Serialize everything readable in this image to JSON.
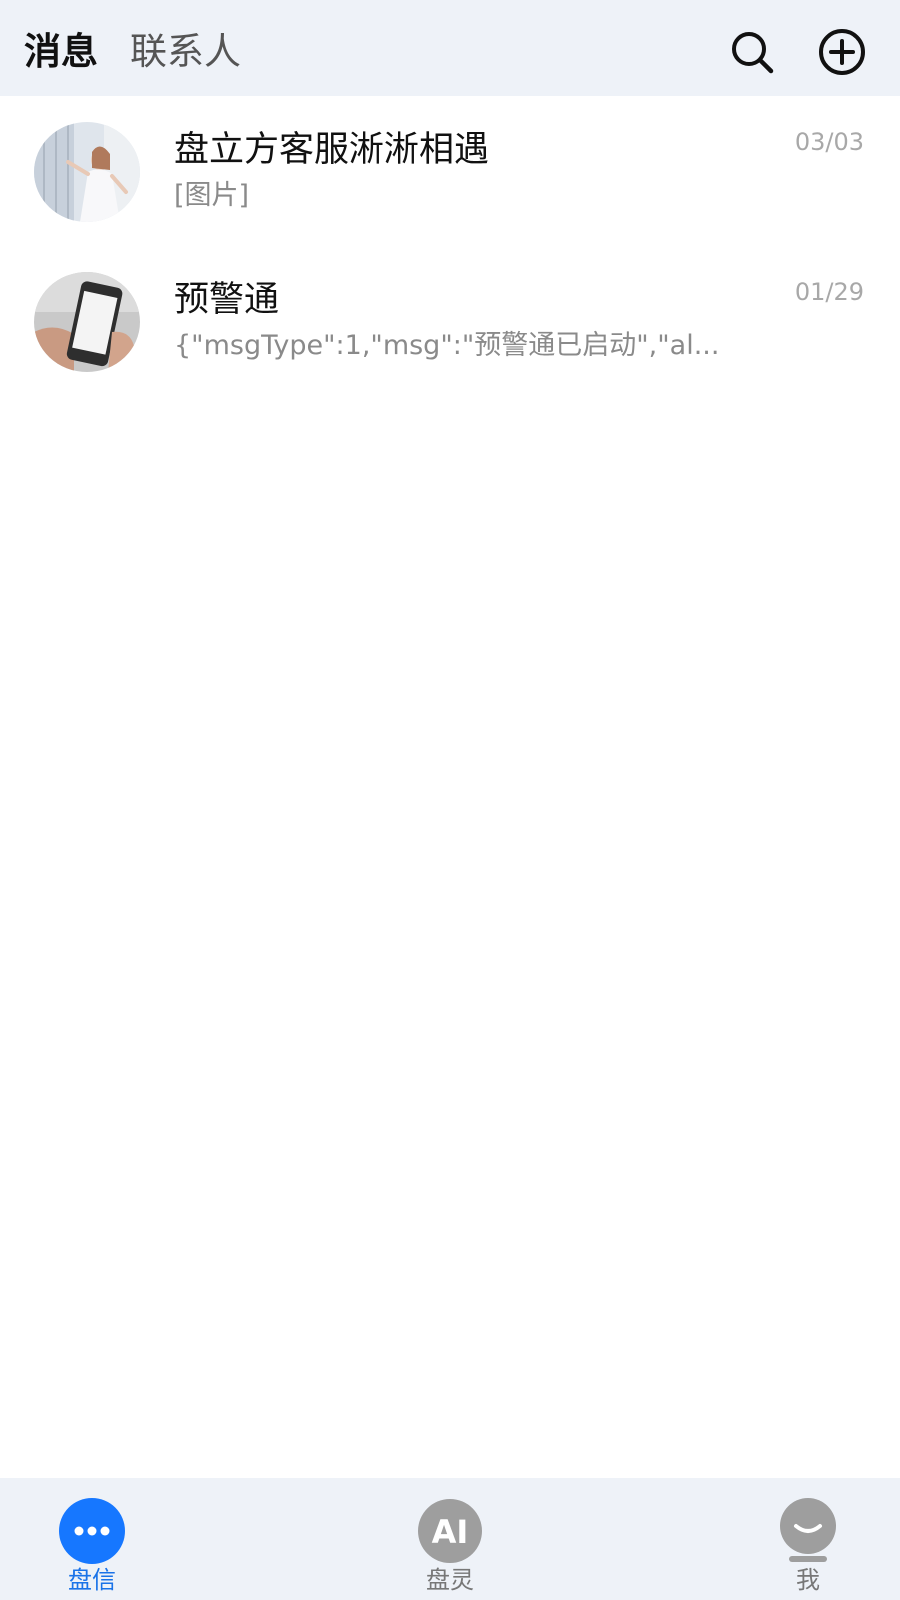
{
  "header": {
    "tabs": {
      "messages": "消息",
      "contacts": "联系人"
    },
    "icons": {
      "search": "search-icon",
      "add": "add-circle-icon"
    }
  },
  "chats": [
    {
      "name": "盘立方客服淅淅相遇",
      "preview": "[图片]",
      "date": "03/03",
      "avatar": "woman-photo-avatar"
    },
    {
      "name": "预警通",
      "preview": "{\"msgType\":1,\"msg\":\"预警通已启动\",\"al...",
      "date": "01/29",
      "avatar": "phone-in-hand-avatar"
    }
  ],
  "bottom_nav": {
    "items": [
      {
        "label": "盘信",
        "icon": "chat-bubble-icon",
        "active": true
      },
      {
        "label": "盘灵",
        "icon": "ai-badge-icon",
        "active": false
      },
      {
        "label": "我",
        "icon": "user-icon",
        "active": false
      }
    ],
    "ai_icon_text": "AI"
  },
  "colors": {
    "accent": "#1a73e8",
    "header_bg": "#eef2f8",
    "inactive_icon": "#9e9e9e"
  }
}
